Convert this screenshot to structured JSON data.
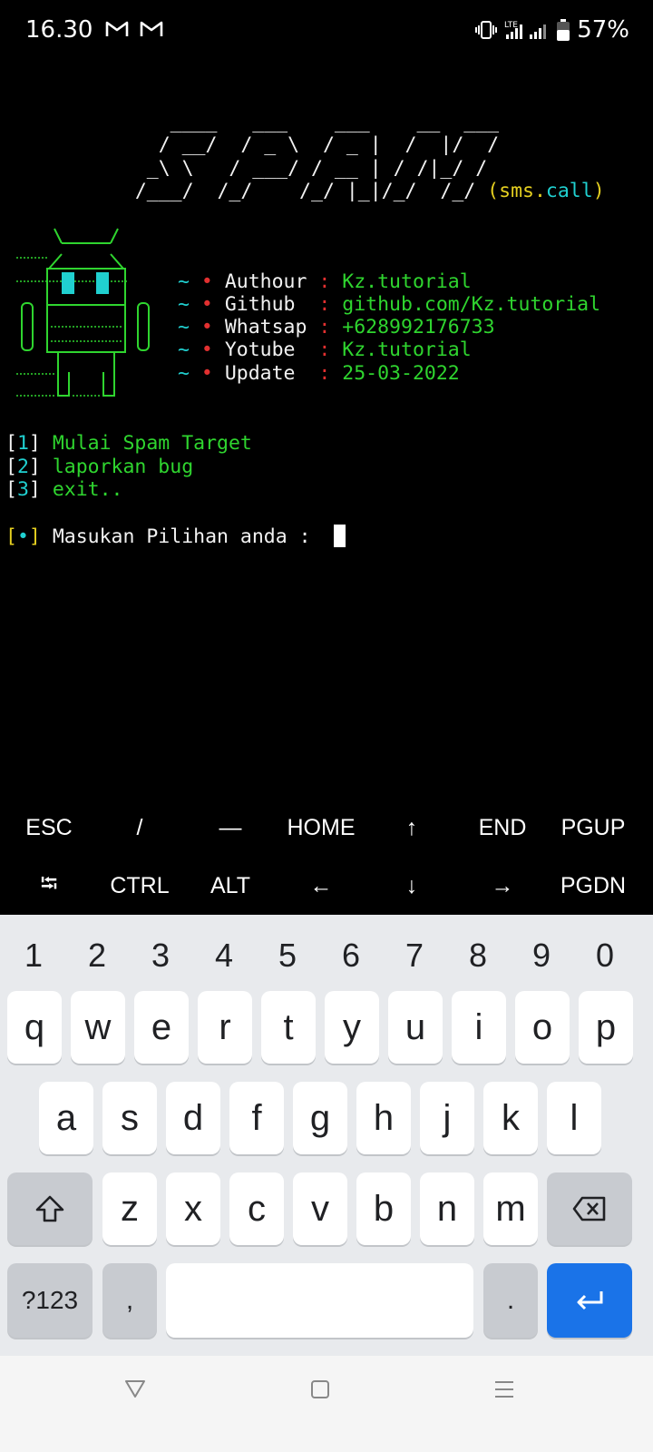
{
  "status_bar": {
    "time": "16.30",
    "notification_icons": [
      "gmail-icon",
      "gmail-icon"
    ],
    "network": "LTE",
    "battery": "57%"
  },
  "terminal": {
    "banner": [
      "      ____   ___    ___    __  ___",
      "     / __/  / _ \\  / _ |  /  |/  /",
      "    _\\ \\   / ___/ / __ | / /|_/ /",
      "   /___/  /_/    /_/ |_|/_/  /_/"
    ],
    "banner_tag_open": "(",
    "banner_tag_sms": "sms.",
    "banner_tag_call": "call",
    "banner_tag_close": ")",
    "info": [
      {
        "label": "Authour",
        "value": "Kz.tutorial"
      },
      {
        "label": "Github ",
        "value": "github.com/Kz.tutorial"
      },
      {
        "label": "Whatsap",
        "value": "+628992176733"
      },
      {
        "label": "Yotube ",
        "value": "Kz.tutorial"
      },
      {
        "label": "Update ",
        "value": "25-03-2022"
      }
    ],
    "info_prefix": "~",
    "info_bullet": "•",
    "info_sep": ":",
    "menu": [
      {
        "num": "1",
        "text": "Mulai Spam Target"
      },
      {
        "num": "2",
        "text": "laporkan bug"
      },
      {
        "num": "3",
        "text": "exit.."
      }
    ],
    "prompt_marker": "•",
    "prompt_text": "Masukan Pilihan anda :"
  },
  "extra_keys": {
    "row1": [
      "ESC",
      "/",
      "—",
      "HOME",
      "↑",
      "END",
      "PGUP"
    ],
    "row2": [
      "⭾",
      "CTRL",
      "ALT",
      "←",
      "↓",
      "→",
      "PGDN"
    ]
  },
  "keyboard": {
    "numbers": [
      "1",
      "2",
      "3",
      "4",
      "5",
      "6",
      "7",
      "8",
      "9",
      "0"
    ],
    "row1": [
      "q",
      "w",
      "e",
      "r",
      "t",
      "y",
      "u",
      "i",
      "o",
      "p"
    ],
    "row2": [
      "a",
      "s",
      "d",
      "f",
      "g",
      "h",
      "j",
      "k",
      "l"
    ],
    "row3": [
      "z",
      "x",
      "c",
      "v",
      "b",
      "n",
      "m"
    ],
    "symbols_key": "?123",
    "comma_key": ",",
    "period_key": ".",
    "accent_color": "#1a73e8"
  },
  "nav_bar": {
    "icons": [
      "back-icon",
      "home-icon",
      "recents-icon"
    ]
  }
}
